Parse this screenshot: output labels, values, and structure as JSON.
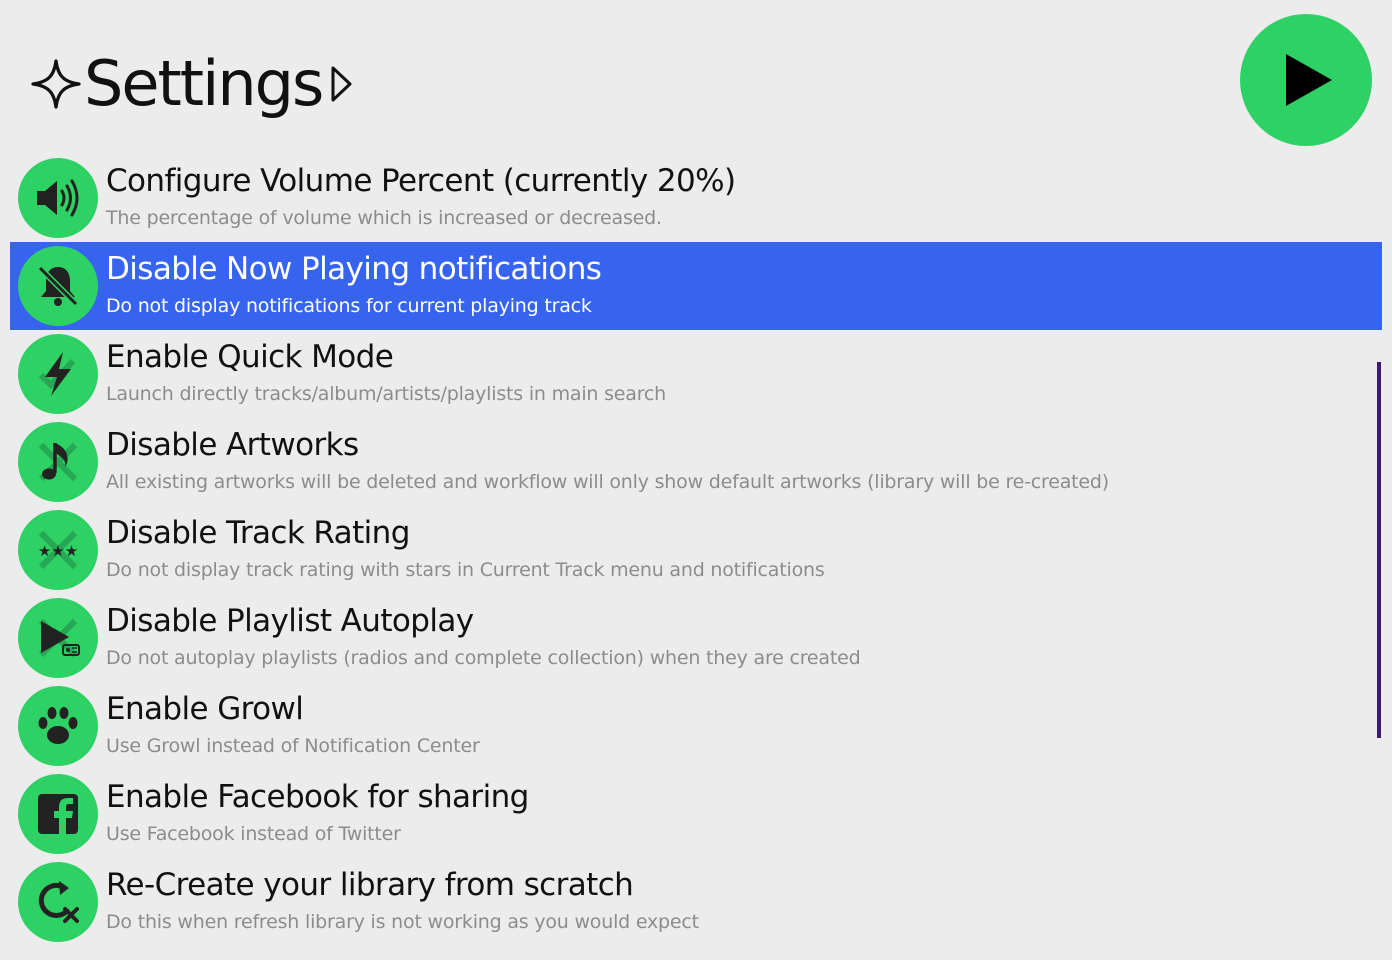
{
  "search": {
    "query": "Settings"
  },
  "colors": {
    "accent_green": "#2ed164",
    "selection_blue": "#3764ef",
    "scrollbar": "#3a1a6e"
  },
  "results": [
    {
      "icon": "volume-icon",
      "title": "Configure Volume Percent (currently 20%)",
      "subtitle": "The percentage of volume which is increased or decreased."
    },
    {
      "icon": "bell-off-icon",
      "title": "Disable Now Playing notifications",
      "subtitle": "Do not display notifications for current playing track",
      "selected": true
    },
    {
      "icon": "lightning-icon",
      "title": "Enable Quick Mode",
      "subtitle": "Launch directly tracks/album/artists/playlists in main search"
    },
    {
      "icon": "music-note-crossed-icon",
      "title": "Disable Artworks",
      "subtitle": "All existing artworks will be deleted and workflow will only show default artworks (library will be re-created)"
    },
    {
      "icon": "stars-crossed-icon",
      "title": "Disable Track Rating",
      "subtitle": "Do not display track rating with stars in Current Track menu and notifications"
    },
    {
      "icon": "play-radio-crossed-icon",
      "title": "Disable Playlist Autoplay",
      "subtitle": "Do not autoplay playlists (radios and complete collection) when they are created"
    },
    {
      "icon": "paw-icon",
      "title": "Enable Growl",
      "subtitle": "Use Growl instead of Notification Center"
    },
    {
      "icon": "facebook-icon",
      "title": "Enable Facebook for sharing",
      "subtitle": "Use Facebook instead of Twitter"
    },
    {
      "icon": "refresh-x-icon",
      "title": "Re-Create your library from scratch",
      "subtitle": "Do this when refresh library is not working as you would expect"
    }
  ]
}
